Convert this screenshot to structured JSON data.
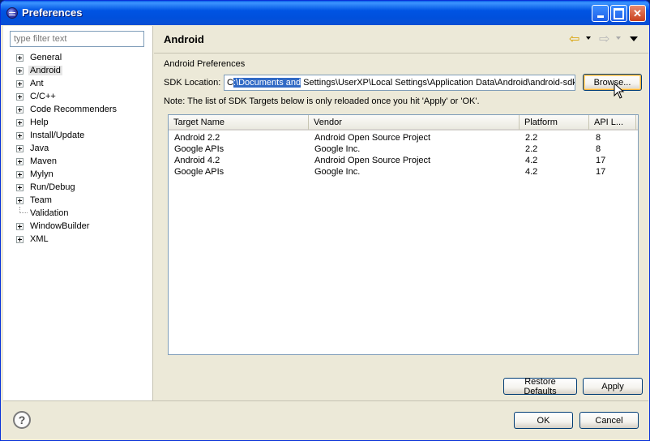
{
  "window": {
    "title": "Preferences",
    "icon": "eclipse-icon"
  },
  "filter": {
    "placeholder": "type filter text"
  },
  "tree": [
    {
      "label": "General",
      "expandable": true
    },
    {
      "label": "Android",
      "expandable": true,
      "selected": true
    },
    {
      "label": "Ant",
      "expandable": true
    },
    {
      "label": "C/C++",
      "expandable": true
    },
    {
      "label": "Code Recommenders",
      "expandable": true
    },
    {
      "label": "Help",
      "expandable": true
    },
    {
      "label": "Install/Update",
      "expandable": true
    },
    {
      "label": "Java",
      "expandable": true
    },
    {
      "label": "Maven",
      "expandable": true
    },
    {
      "label": "Mylyn",
      "expandable": true
    },
    {
      "label": "Run/Debug",
      "expandable": true
    },
    {
      "label": "Team",
      "expandable": true
    },
    {
      "label": "Validation",
      "expandable": false
    },
    {
      "label": "WindowBuilder",
      "expandable": true
    },
    {
      "label": "XML",
      "expandable": true
    }
  ],
  "page": {
    "title": "Android",
    "section": "Android Preferences",
    "sdk_label": "SDK Location:",
    "sdk_value_pre": "C",
    "sdk_value_sel": ":\\Documents and",
    "sdk_value_post": " Settings\\UserXP\\Local Settings\\Application Data\\Android\\android-sdk",
    "browse": "Browse...",
    "note": "Note: The list of SDK Targets below is only reloaded once you hit 'Apply' or 'OK'.",
    "restore_defaults": "Restore Defaults",
    "apply": "Apply"
  },
  "table": {
    "columns": [
      "Target Name",
      "Vendor",
      "Platform",
      "API L..."
    ],
    "rows": [
      [
        "Android 2.2",
        "Android Open Source Project",
        "2.2",
        "8"
      ],
      [
        "Google APIs",
        "Google Inc.",
        "2.2",
        "8"
      ],
      [
        "Android 4.2",
        "Android Open Source Project",
        "4.2",
        "17"
      ],
      [
        "Google APIs",
        "Google Inc.",
        "4.2",
        "17"
      ]
    ]
  },
  "footer": {
    "ok": "OK",
    "cancel": "Cancel"
  },
  "colors": {
    "titlebar": "#0054e3",
    "selection": "#316ac5",
    "background": "#ece9d8"
  }
}
